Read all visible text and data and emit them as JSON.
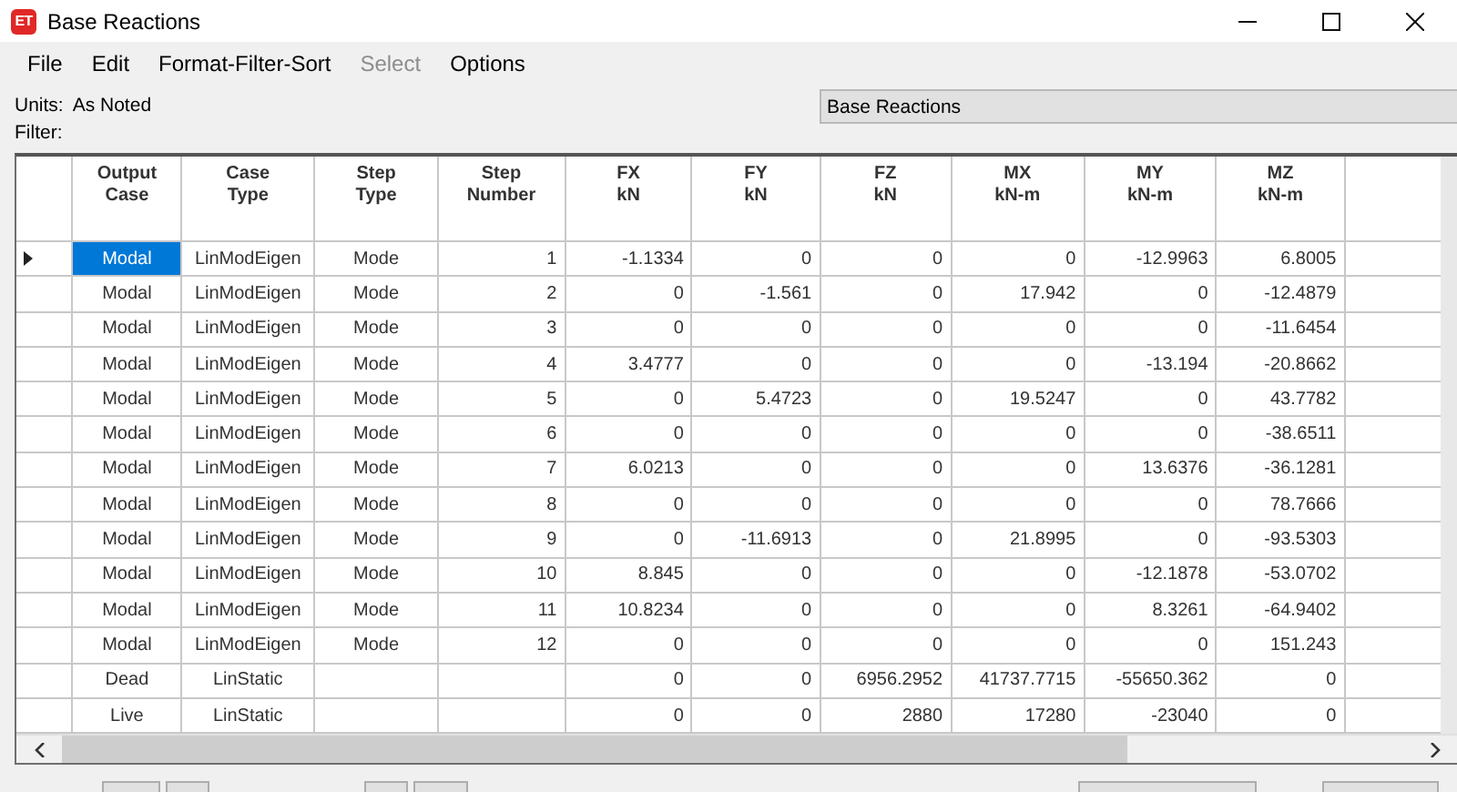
{
  "window": {
    "icon_text": "ET",
    "title": "Base Reactions"
  },
  "menu": [
    {
      "label": "File",
      "disabled": false
    },
    {
      "label": "Edit",
      "disabled": false
    },
    {
      "label": "Format-Filter-Sort",
      "disabled": false
    },
    {
      "label": "Select",
      "disabled": true
    },
    {
      "label": "Options",
      "disabled": false
    }
  ],
  "info": {
    "units_label": "Units:",
    "units_value": "As Noted",
    "filter_label": "Filter:",
    "table_name": "Base Reactions"
  },
  "table": {
    "columns": [
      {
        "title": "Output",
        "subtitle": "Case",
        "kind": "text"
      },
      {
        "title": "Case",
        "subtitle": "Type",
        "kind": "text"
      },
      {
        "title": "Step",
        "subtitle": "Type",
        "kind": "text"
      },
      {
        "title": "Step",
        "subtitle": "Number",
        "kind": "number"
      },
      {
        "title": "FX",
        "subtitle": "kN",
        "kind": "number"
      },
      {
        "title": "FY",
        "subtitle": "kN",
        "kind": "number"
      },
      {
        "title": "FZ",
        "subtitle": "kN",
        "kind": "number"
      },
      {
        "title": "MX",
        "subtitle": "kN-m",
        "kind": "number"
      },
      {
        "title": "MY",
        "subtitle": "kN-m",
        "kind": "number"
      },
      {
        "title": "MZ",
        "subtitle": "kN-m",
        "kind": "number"
      }
    ],
    "rows": [
      {
        "selected": true,
        "cells": [
          "Modal",
          "LinModEigen",
          "Mode",
          "1",
          "-1.1334",
          "0",
          "0",
          "0",
          "-12.9963",
          "6.8005"
        ]
      },
      {
        "selected": false,
        "cells": [
          "Modal",
          "LinModEigen",
          "Mode",
          "2",
          "0",
          "-1.561",
          "0",
          "17.942",
          "0",
          "-12.4879"
        ]
      },
      {
        "selected": false,
        "cells": [
          "Modal",
          "LinModEigen",
          "Mode",
          "3",
          "0",
          "0",
          "0",
          "0",
          "0",
          "-11.6454"
        ]
      },
      {
        "selected": false,
        "cells": [
          "Modal",
          "LinModEigen",
          "Mode",
          "4",
          "3.4777",
          "0",
          "0",
          "0",
          "-13.194",
          "-20.8662"
        ]
      },
      {
        "selected": false,
        "cells": [
          "Modal",
          "LinModEigen",
          "Mode",
          "5",
          "0",
          "5.4723",
          "0",
          "19.5247",
          "0",
          "43.7782"
        ]
      },
      {
        "selected": false,
        "cells": [
          "Modal",
          "LinModEigen",
          "Mode",
          "6",
          "0",
          "0",
          "0",
          "0",
          "0",
          "-38.6511"
        ]
      },
      {
        "selected": false,
        "cells": [
          "Modal",
          "LinModEigen",
          "Mode",
          "7",
          "6.0213",
          "0",
          "0",
          "0",
          "13.6376",
          "-36.1281"
        ]
      },
      {
        "selected": false,
        "cells": [
          "Modal",
          "LinModEigen",
          "Mode",
          "8",
          "0",
          "0",
          "0",
          "0",
          "0",
          "78.7666"
        ]
      },
      {
        "selected": false,
        "cells": [
          "Modal",
          "LinModEigen",
          "Mode",
          "9",
          "0",
          "-11.6913",
          "0",
          "21.8995",
          "0",
          "-93.5303"
        ]
      },
      {
        "selected": false,
        "cells": [
          "Modal",
          "LinModEigen",
          "Mode",
          "10",
          "8.845",
          "0",
          "0",
          "0",
          "-12.1878",
          "-53.0702"
        ]
      },
      {
        "selected": false,
        "cells": [
          "Modal",
          "LinModEigen",
          "Mode",
          "11",
          "10.8234",
          "0",
          "0",
          "0",
          "8.3261",
          "-64.9402"
        ]
      },
      {
        "selected": false,
        "cells": [
          "Modal",
          "LinModEigen",
          "Mode",
          "12",
          "0",
          "0",
          "0",
          "0",
          "0",
          "151.243"
        ]
      },
      {
        "selected": false,
        "cells": [
          "Dead",
          "LinStatic",
          "",
          "",
          "0",
          "0",
          "6956.2952",
          "41737.7715",
          "-55650.362",
          "0"
        ]
      },
      {
        "selected": false,
        "cells": [
          "Live",
          "LinStatic",
          "",
          "",
          "0",
          "0",
          "2880",
          "17280",
          "-23040",
          "0"
        ]
      }
    ]
  }
}
